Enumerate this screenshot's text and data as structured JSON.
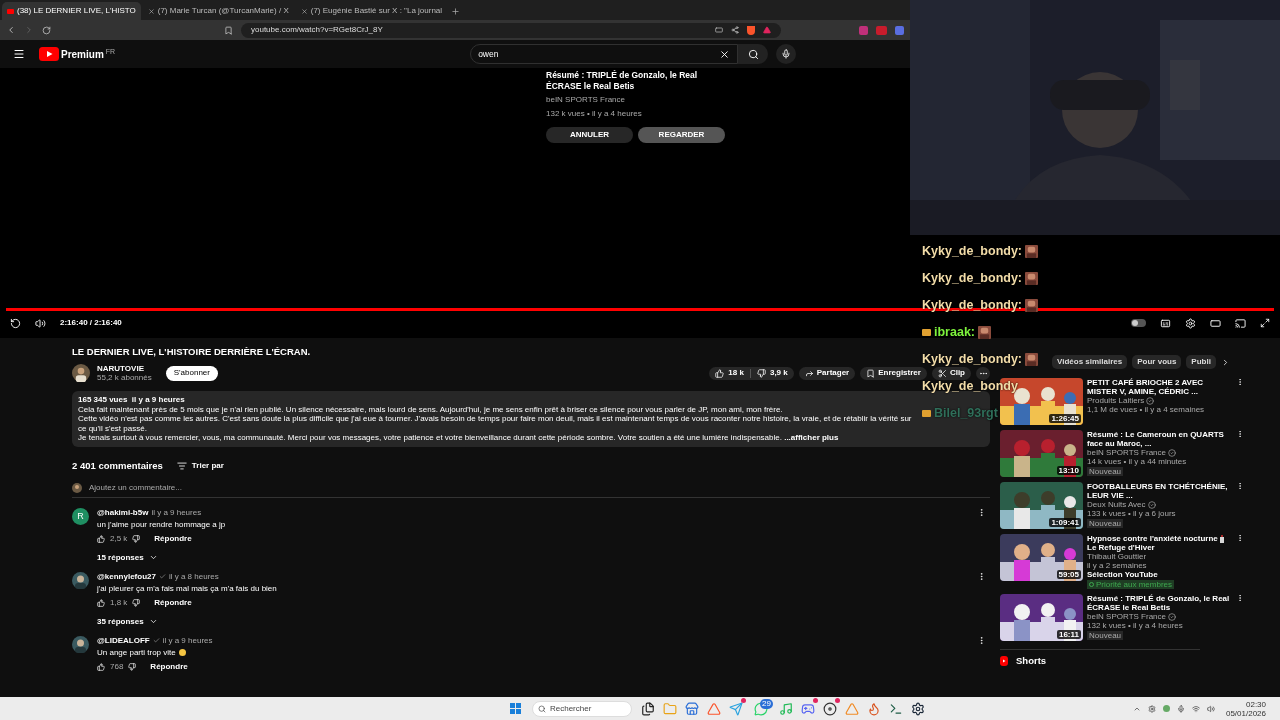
{
  "browser": {
    "tabs": [
      {
        "title": "(38) LE DERNIER LIVE, L'HISTO",
        "selected": true,
        "kind": "youtube"
      },
      {
        "title": "(7) Marie Turcan (@TurcanMarie) / X",
        "selected": false,
        "kind": "x"
      },
      {
        "title": "(7) Eugénie Bastié sur X : \"La journal",
        "selected": false,
        "kind": "x"
      }
    ],
    "url": "youtube.com/watch?v=RGet8CrJ_8Y"
  },
  "header": {
    "logo": "Premium",
    "region": "FR",
    "search": {
      "value": "owen"
    }
  },
  "end_screen": {
    "title": "Résumé : TRIPLÉ de Gonzalo, le Real ÉCRASE le Real Betis",
    "channel": "beIN SPORTS France",
    "meta": "132 k vues • il y a 4 heures",
    "buttons": [
      {
        "label": "ANNULER",
        "kind": "cancel"
      },
      {
        "label": "REGARDER",
        "kind": "watch"
      }
    ]
  },
  "player": {
    "level": 1,
    "time": "2:16:40 / 2:16:40",
    "autoplay": false
  },
  "video": {
    "title": "LE DERNIER LIVE, L'HISTOIRE DERRIÈRE L'ÉCRAN.",
    "channel": "NARUTOVIE",
    "subscribers": "55,2 k abonnés",
    "subscribe": "S'abonner",
    "likes": "18 k",
    "dislikes": "3,9 k",
    "share": "Partager",
    "save": "Enregistrer",
    "clip": "Clip"
  },
  "description": {
    "stats": "165 345 vues  il y a 9 heures",
    "lines": [
      "Cela fait maintenant près de 5 mois que je n'ai rien publié. Un silence nécessaire, mais lourd de sens. Aujourd'hui, je me sens enfin prêt à briser ce silence pour vous parler de JP, mon ami, mon frère.",
      "Cette vidéo n'est pas comme les autres. C'est sans doute la plus difficile que j'ai eue à tourner. J'avais besoin de temps pour faire mon deuil, mais il est maintenant temps de vous raconter notre histoire, la vraie, et de rétablir la vérité sur ce qu'il s'est passé.",
      "Je tenais surtout à vous remercier, vous, ma communauté. Merci pour vos messages, votre patience et votre bienveillance durant cette période sombre. Votre soutien a été une lumière indispensable."
    ],
    "more": "...afficher plus"
  },
  "comments": {
    "count": "2 401 commentaires",
    "sort": "Trier par",
    "placeholder": "Ajoutez un commentaire...",
    "items": [
      {
        "author": "@hakimi-b5w",
        "verified": false,
        "time": "il y a 9 heures",
        "text": "un j'aime pour rendre hommage a jp",
        "emoji": false,
        "likes": "2,5 k",
        "reply": "Répondre",
        "replies": "15 réponses",
        "avatar": {
          "kind": "letter",
          "letter": "R",
          "color": "#1f8f62"
        }
      },
      {
        "author": "@kennylefou27",
        "verified": true,
        "time": "il y a 8 heures",
        "text": "j'ai pleurer ça m'a fais mal mais ça m'a fais du bien",
        "emoji": false,
        "likes": "1,8 k",
        "reply": "Répondre",
        "replies": "35 réponses"
      },
      {
        "author": "@LIDEALOFF",
        "verified": true,
        "time": "il y a 9 heures",
        "text": "Un ange parti trop vite",
        "emoji": true,
        "likes": "768",
        "reply": "Répondre"
      }
    ]
  },
  "sidebar": {
    "chips": [
      {
        "label": "Vidéos similaires",
        "selected": false
      },
      {
        "label": "Pour vous",
        "selected": false
      },
      {
        "label": "Publi",
        "selected": false
      }
    ],
    "videos": [
      {
        "title": "PETIT CAFÉ BRIOCHE 2 AVEC MISTER V, AMINE, CÉDRIC ...",
        "channel": "Produits Laitiers",
        "verified": true,
        "meta": "1,1 M de vues • il y a 4 semaines",
        "duration": "1:26:45"
      },
      {
        "title": "Résumé : Le Cameroun en QUARTS face au Maroc, ...",
        "channel": "beIN SPORTS France",
        "verified": true,
        "meta": "14 k vues • il y a 44 minutes",
        "badge": "Nouveau",
        "duration": "13:10"
      },
      {
        "title": "FOOTBALLEURS EN TCHÉTCHÉNIE, LEUR VIE ...",
        "channel": "Deux Nuits Avec",
        "verified": true,
        "meta": "133 k vues • il y a 6 jours",
        "badge": "Nouveau",
        "duration": "1:09:41"
      },
      {
        "title": "Hypnose contre l'anxiété nocturne",
        "title_end": "Le Refuge d'Hiver",
        "channel": "Thibault Gouttier",
        "verified": false,
        "meta": "il y a 2 semaines",
        "extra": "Sélection YouTube",
        "member": "Priorité aux membres",
        "duration": "59:05"
      },
      {
        "title": "Résumé : TRIPLÉ de Gonzalo, le Real ÉCRASE le Real Betis",
        "channel": "beIN SPORTS France",
        "verified": true,
        "meta": "132 k vues • il y a 4 heures",
        "badge": "Nouveau",
        "duration": "16:11"
      }
    ],
    "shorts": "Shorts"
  },
  "chat": [
    {
      "user": "Kyky_de_bondy:",
      "color": "#f2dca8",
      "badge": false,
      "emote": true
    },
    {
      "user": "Kyky_de_bondy:",
      "color": "#f2dca8",
      "badge": false,
      "emote": true
    },
    {
      "user": "Kyky_de_bondy:",
      "color": "#f2dca8",
      "badge": false,
      "emote": true
    },
    {
      "user": "ibraak:",
      "color": "#7df23c",
      "badge": true,
      "emote": true
    },
    {
      "user": "Kyky_de_bondy:",
      "color": "#f2dca8",
      "badge": false,
      "emote": true
    },
    {
      "user": "Kyky_de_bondy",
      "color": "#f2dca8",
      "badge": false,
      "emote": false
    },
    {
      "user": "Bilel_93rgt",
      "color": "#2f6f5a",
      "badge": true,
      "emote": false
    }
  ],
  "taskbar": {
    "search": "Rechercher",
    "time": "02:30",
    "date": "05/01/2026",
    "apps": [
      {
        "kind": "files"
      },
      {
        "kind": "folder"
      },
      {
        "kind": "store"
      },
      {
        "kind": "brave"
      },
      {
        "kind": "telegram",
        "notification": true
      },
      {
        "kind": "whatsapp",
        "badge": "29"
      },
      {
        "kind": "spotify"
      },
      {
        "kind": "discord",
        "notification": true
      },
      {
        "kind": "obs",
        "notification": true
      },
      {
        "kind": "vlc"
      },
      {
        "kind": "game"
      },
      {
        "kind": "terminal"
      },
      {
        "kind": "steam"
      }
    ]
  }
}
